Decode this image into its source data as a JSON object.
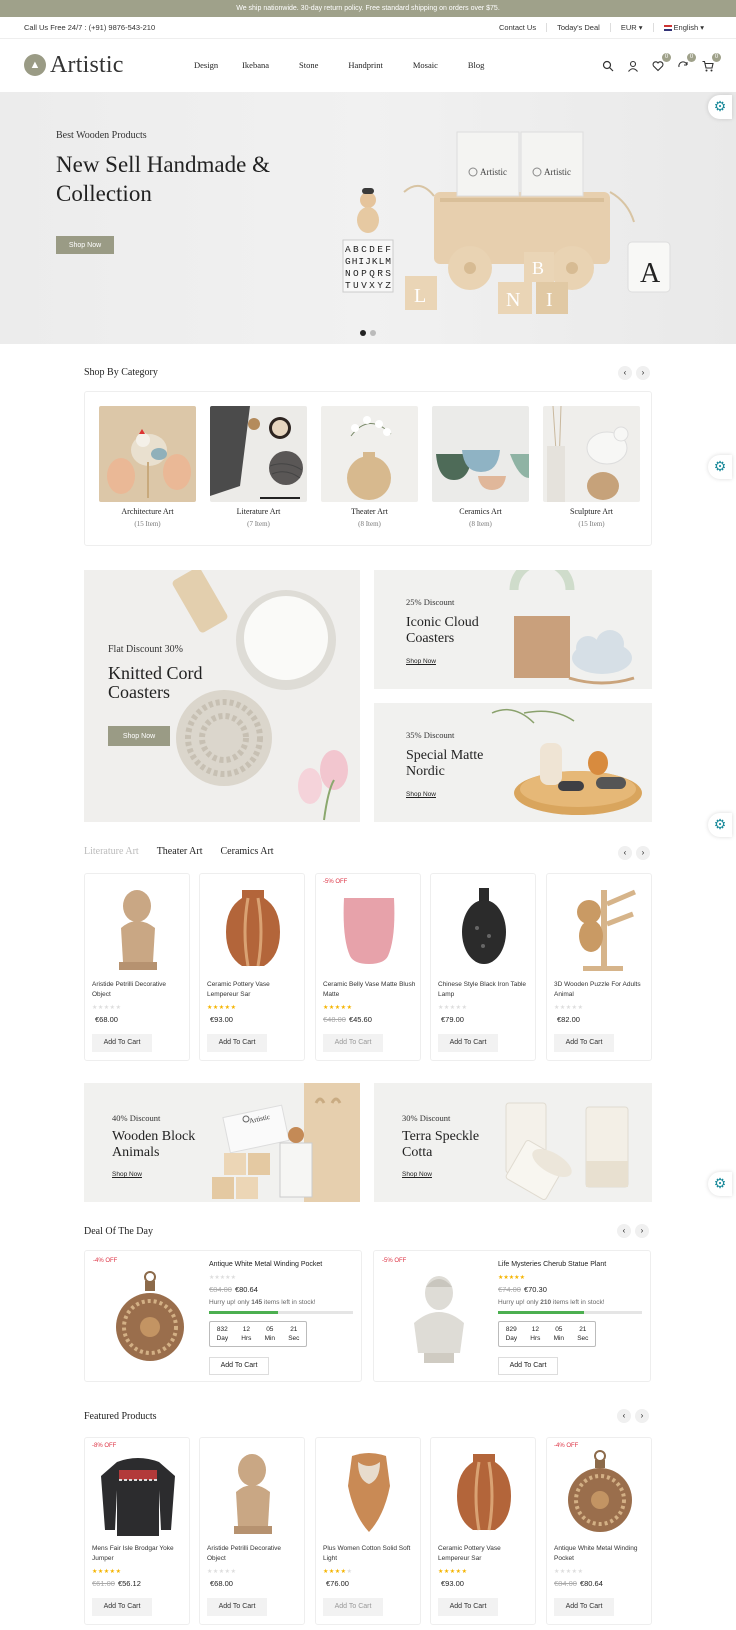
{
  "announcement": "We ship nationwide. 30-day return policy. Free standard shipping on orders over $75.",
  "topbar": {
    "phone": "Call Us Free 24/7 : (+91) 9876-543-210",
    "links": [
      "Contact Us",
      "Today's Deal"
    ],
    "currency": "EUR",
    "language": "English"
  },
  "header": {
    "brand": "Artistic",
    "nav": [
      "Design",
      "Ikebana",
      "Stone",
      "Handprint",
      "Mosaic",
      "Blog"
    ],
    "wishlist_count": "0",
    "compare_count": "0",
    "cart_count": "0"
  },
  "hero": {
    "subtitle": "Best Wooden Products",
    "title": "New Sell Handmade & Collection",
    "button": "Shop Now",
    "box_label_1": "Artistic",
    "box_label_2": "Artistic",
    "block_letters": "ABCDEF GHIJKLM NOPQRS TUVXYZ",
    "cube_letters": [
      "L",
      "B",
      "N",
      "I"
    ],
    "mug_letter": "A"
  },
  "categories": {
    "title": "Shop By Category",
    "items": [
      {
        "name": "Architecture Art",
        "count": "(15 Item)"
      },
      {
        "name": "Literature Art",
        "count": "(7 Item)"
      },
      {
        "name": "Theater Art",
        "count": "(8 Item)"
      },
      {
        "name": "Ceramics Art",
        "count": "(8 Item)"
      },
      {
        "name": "Sculpture Art",
        "count": "(15 Item)"
      }
    ]
  },
  "banners": {
    "big": {
      "discount": "Flat Discount 30%",
      "title": "Knitted Cord Coasters",
      "button": "Shop Now"
    },
    "top": {
      "discount": "25% Discount",
      "title": "Iconic Cloud Coasters",
      "link": "Shop Now"
    },
    "bottom": {
      "discount": "35% Discount",
      "title": "Special Matte Nordic",
      "link": "Shop Now"
    },
    "left2": {
      "discount": "40% Discount",
      "title": "Wooden Block Animals",
      "link": "Shop Now",
      "box_label": "Artistic"
    },
    "right2": {
      "discount": "30% Discount",
      "title": "Terra Speckle Cotta",
      "link": "Shop Now"
    }
  },
  "tabs": [
    "Literature Art",
    "Theater Art",
    "Ceramics Art"
  ],
  "products": [
    {
      "name": "Aristide Petrilli Decorative Object",
      "price": "€68.00",
      "old": "",
      "tag": "",
      "rating": 0,
      "cart": "Add To Cart"
    },
    {
      "name": "Ceramic Pottery Vase Lempereur Sar",
      "price": "€93.00",
      "old": "",
      "tag": "",
      "rating": 5,
      "cart": "Add To Cart"
    },
    {
      "name": "Ceramic Belly Vase Matte Blush Matte",
      "price": "€45.60",
      "old": "€48.00",
      "tag": "-5% OFF",
      "rating": 5,
      "cart": "Add To Cart"
    },
    {
      "name": "Chinese Style Black Iron Table Lamp",
      "price": "€79.00",
      "old": "",
      "tag": "",
      "rating": 0,
      "cart": "Add To Cart"
    },
    {
      "name": "3D Wooden Puzzle For Adults Animal",
      "price": "€82.00",
      "old": "",
      "tag": "",
      "rating": 0,
      "cart": "Add To Cart"
    }
  ],
  "deals": {
    "title": "Deal Of The Day",
    "items": [
      {
        "tag": "-4% OFF",
        "name": "Antique White Metal Winding Pocket",
        "old": "€84.00",
        "price": "€80.64",
        "hurry_pre": "Hurry up! only ",
        "left": "145",
        "hurry_post": " items left in stock!",
        "sold": 0.48,
        "timer": [
          [
            "832",
            "Day"
          ],
          [
            "12",
            "Hrs"
          ],
          [
            "05",
            "Min"
          ],
          [
            "21",
            "Sec"
          ]
        ],
        "cart": "Add To Cart"
      },
      {
        "tag": "-5% OFF",
        "name": "Life Mysteries Cherub Statue Plant",
        "old": "€74.00",
        "price": "€70.30",
        "hurry_pre": "Hurry up! only ",
        "left": "210",
        "hurry_post": " items left in stock!",
        "sold": 0.6,
        "timer": [
          [
            "829",
            "Day"
          ],
          [
            "12",
            "Hrs"
          ],
          [
            "05",
            "Min"
          ],
          [
            "21",
            "Sec"
          ]
        ],
        "cart": "Add To Cart"
      }
    ]
  },
  "featured": {
    "title": "Featured Products",
    "items": [
      {
        "name": "Mens Fair Isle Brodgar Yoke Jumper",
        "price": "€56.12",
        "old": "€61.00",
        "tag": "-8% OFF",
        "rating": 5,
        "cart": "Add To Cart"
      },
      {
        "name": "Aristide Petrilli Decorative Object",
        "price": "€68.00",
        "old": "",
        "tag": "",
        "rating": 0,
        "cart": "Add To Cart"
      },
      {
        "name": "Plus Women Cotton Solid Soft Light",
        "price": "€76.00",
        "old": "",
        "tag": "",
        "rating": 4,
        "cart": "Add To Cart"
      },
      {
        "name": "Ceramic Pottery Vase Lempereur Sar",
        "price": "€93.00",
        "old": "",
        "tag": "",
        "rating": 5,
        "cart": "Add To Cart"
      },
      {
        "name": "Antique White Metal Winding Pocket",
        "price": "€80.64",
        "old": "€84.00",
        "tag": "-4% OFF",
        "rating": 0,
        "cart": "Add To Cart"
      }
    ]
  },
  "colors": {
    "olive": "#9a9b85",
    "sale": "#d34",
    "star": "#f5b400",
    "progress": "#4caf50"
  }
}
